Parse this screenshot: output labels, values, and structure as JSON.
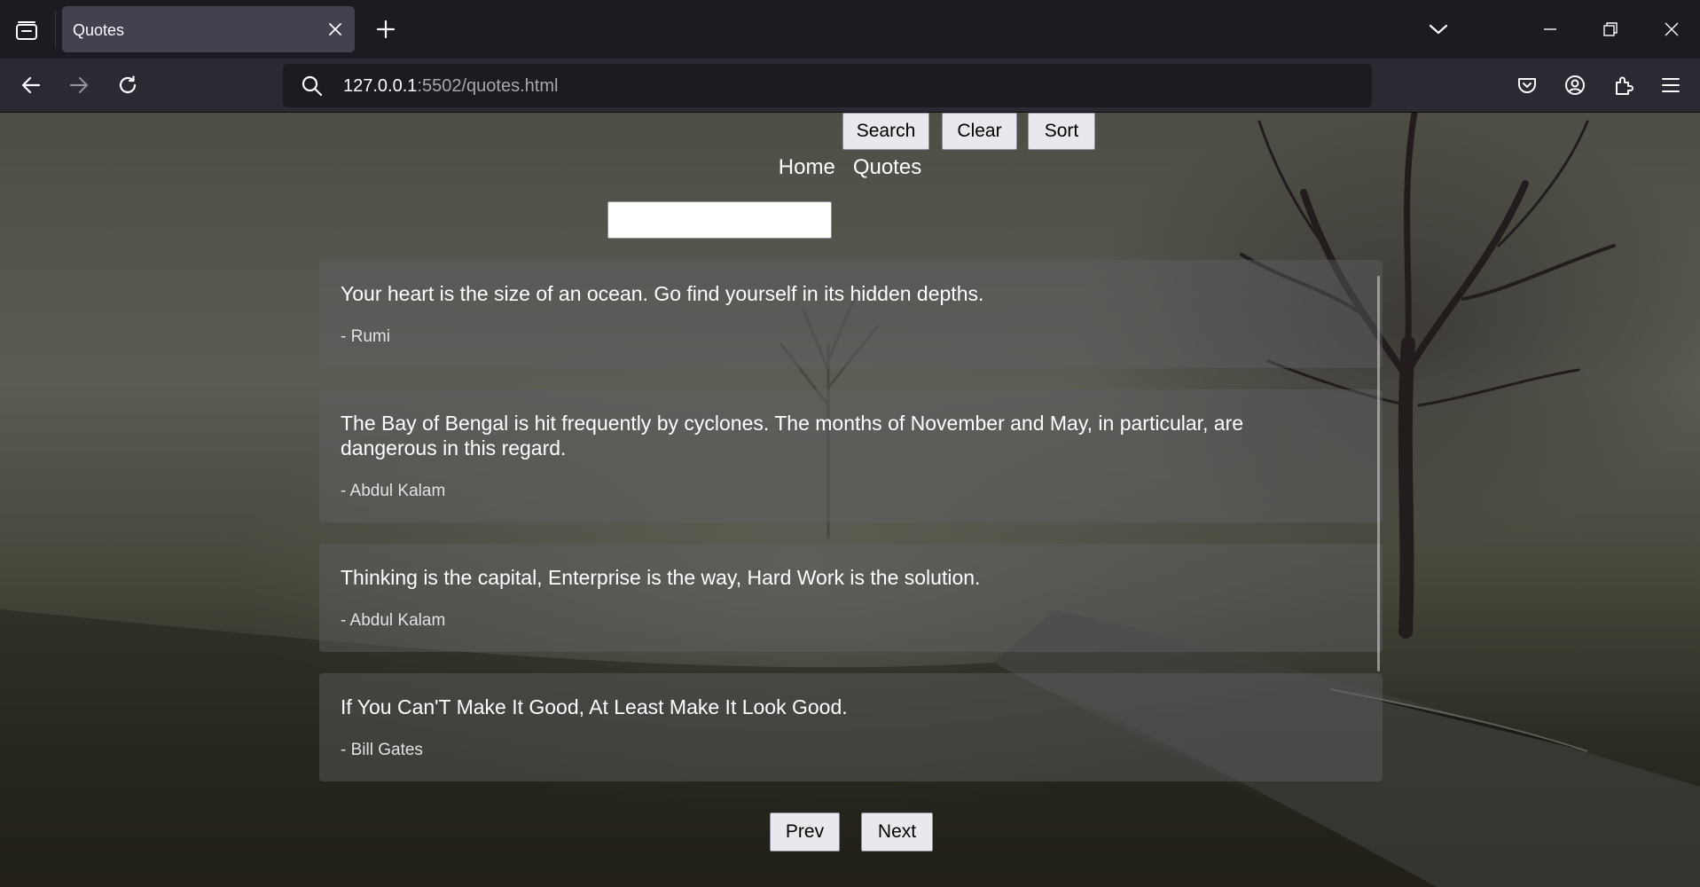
{
  "browser": {
    "tab_title": "Quotes",
    "url_host": "127.0.0.1",
    "url_path": ":5502/quotes.html"
  },
  "nav_menu": {
    "home": "Home",
    "quotes": "Quotes"
  },
  "search": {
    "value": "",
    "placeholder": "",
    "search_label": "Search",
    "clear_label": "Clear",
    "sort_label": "Sort"
  },
  "quotes": [
    {
      "text": "Your heart is the size of an ocean. Go find yourself in its hidden depths.",
      "author": "- Rumi"
    },
    {
      "text": "The Bay of Bengal is hit frequently by cyclones. The months of November and May, in particular, are dangerous in this regard.",
      "author": "- Abdul Kalam"
    },
    {
      "text": "Thinking is the capital, Enterprise is the way, Hard Work is the solution.",
      "author": "- Abdul Kalam"
    },
    {
      "text": "If You Can'T Make It Good, At Least Make It Look Good.",
      "author": "- Bill Gates"
    }
  ],
  "pagination": {
    "prev_label": "Prev",
    "next_label": "Next"
  },
  "icons": {
    "tab_list": "tab-list-icon",
    "close_tab": "close-icon",
    "new_tab": "plus-icon",
    "list_all_tabs": "chevron-down-icon",
    "minimize": "minimize-icon",
    "restore": "restore-icon",
    "close_window": "close-icon",
    "back": "back-arrow-icon",
    "forward": "forward-arrow-icon",
    "reload": "reload-icon",
    "url_search": "search-icon",
    "pocket": "pocket-icon",
    "account": "account-icon",
    "extensions": "extensions-icon",
    "app_menu": "hamburger-menu-icon"
  },
  "colors": {
    "chrome_dark": "#1c1b22",
    "toolbar": "#2b2a33",
    "active_tab": "#42414d",
    "button_bg": "#e9e9ed"
  }
}
